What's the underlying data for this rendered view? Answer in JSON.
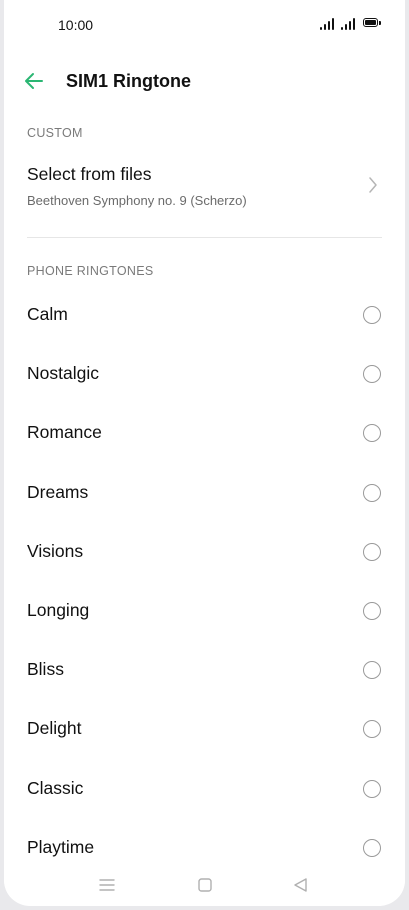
{
  "status_bar": {
    "time": "10:00"
  },
  "header": {
    "title": "SIM1 Ringtone",
    "back_icon": "arrow-left-icon"
  },
  "accent_color": "#2bb673",
  "custom_section": {
    "label": "CUSTOM",
    "item": {
      "title": "Select from files",
      "subtitle": "Beethoven Symphony no. 9 (Scherzo)"
    }
  },
  "ringtones_section": {
    "label": "PHONE RINGTONES",
    "items": [
      {
        "label": "Calm"
      },
      {
        "label": "Nostalgic"
      },
      {
        "label": "Romance"
      },
      {
        "label": "Dreams"
      },
      {
        "label": "Visions"
      },
      {
        "label": "Longing"
      },
      {
        "label": "Bliss"
      },
      {
        "label": "Delight"
      },
      {
        "label": "Classic"
      },
      {
        "label": "Playtime"
      }
    ]
  },
  "nav_bar": {
    "icons": [
      "menu-icon",
      "home-icon",
      "back-icon"
    ]
  }
}
